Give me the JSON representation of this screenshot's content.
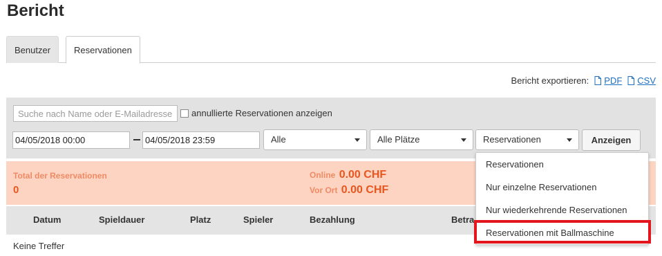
{
  "page": {
    "title": "Bericht"
  },
  "tabs": [
    {
      "label": "Benutzer",
      "active": false
    },
    {
      "label": "Reservationen",
      "active": true
    }
  ],
  "export": {
    "label": "Bericht exportieren:",
    "pdf": "PDF",
    "csv": "CSV"
  },
  "filters": {
    "search_placeholder": "Suche nach Name oder E-Mailadresse",
    "cancelled_checkbox_label": "annullierte Reservationen anzeigen",
    "cancelled_checked": false,
    "date_from": "04/05/2018 00:00",
    "date_to": "04/05/2018 23:59",
    "select_type": "Alle",
    "select_courts": "Alle Plätze",
    "select_reservations": "Reservationen",
    "show_button": "Anzeigen"
  },
  "summary": {
    "total_label": "Total der Reservationen",
    "total_count": "0",
    "online_label": "Online",
    "online_amount": "0.00 CHF",
    "vorort_label": "Vor Ort",
    "vorort_amount": "0.00 CHF"
  },
  "table": {
    "headers": [
      "Datum",
      "Spieldauer",
      "Platz",
      "Spieler",
      "Bezahlung",
      "Betra"
    ],
    "empty_message": "Keine Treffer"
  },
  "dropdown": {
    "options": [
      "Reservationen",
      "Nur einzelne Reservationen",
      "Nur wiederkehrende Reservationen",
      "Reservationen mit Ballmaschine"
    ],
    "highlighted_index": 3
  },
  "colors": {
    "summary_bg": "#fdd4c2",
    "summary_accent": "#e8561f",
    "highlight_border": "#e3161e",
    "link": "#1e6fc2"
  }
}
